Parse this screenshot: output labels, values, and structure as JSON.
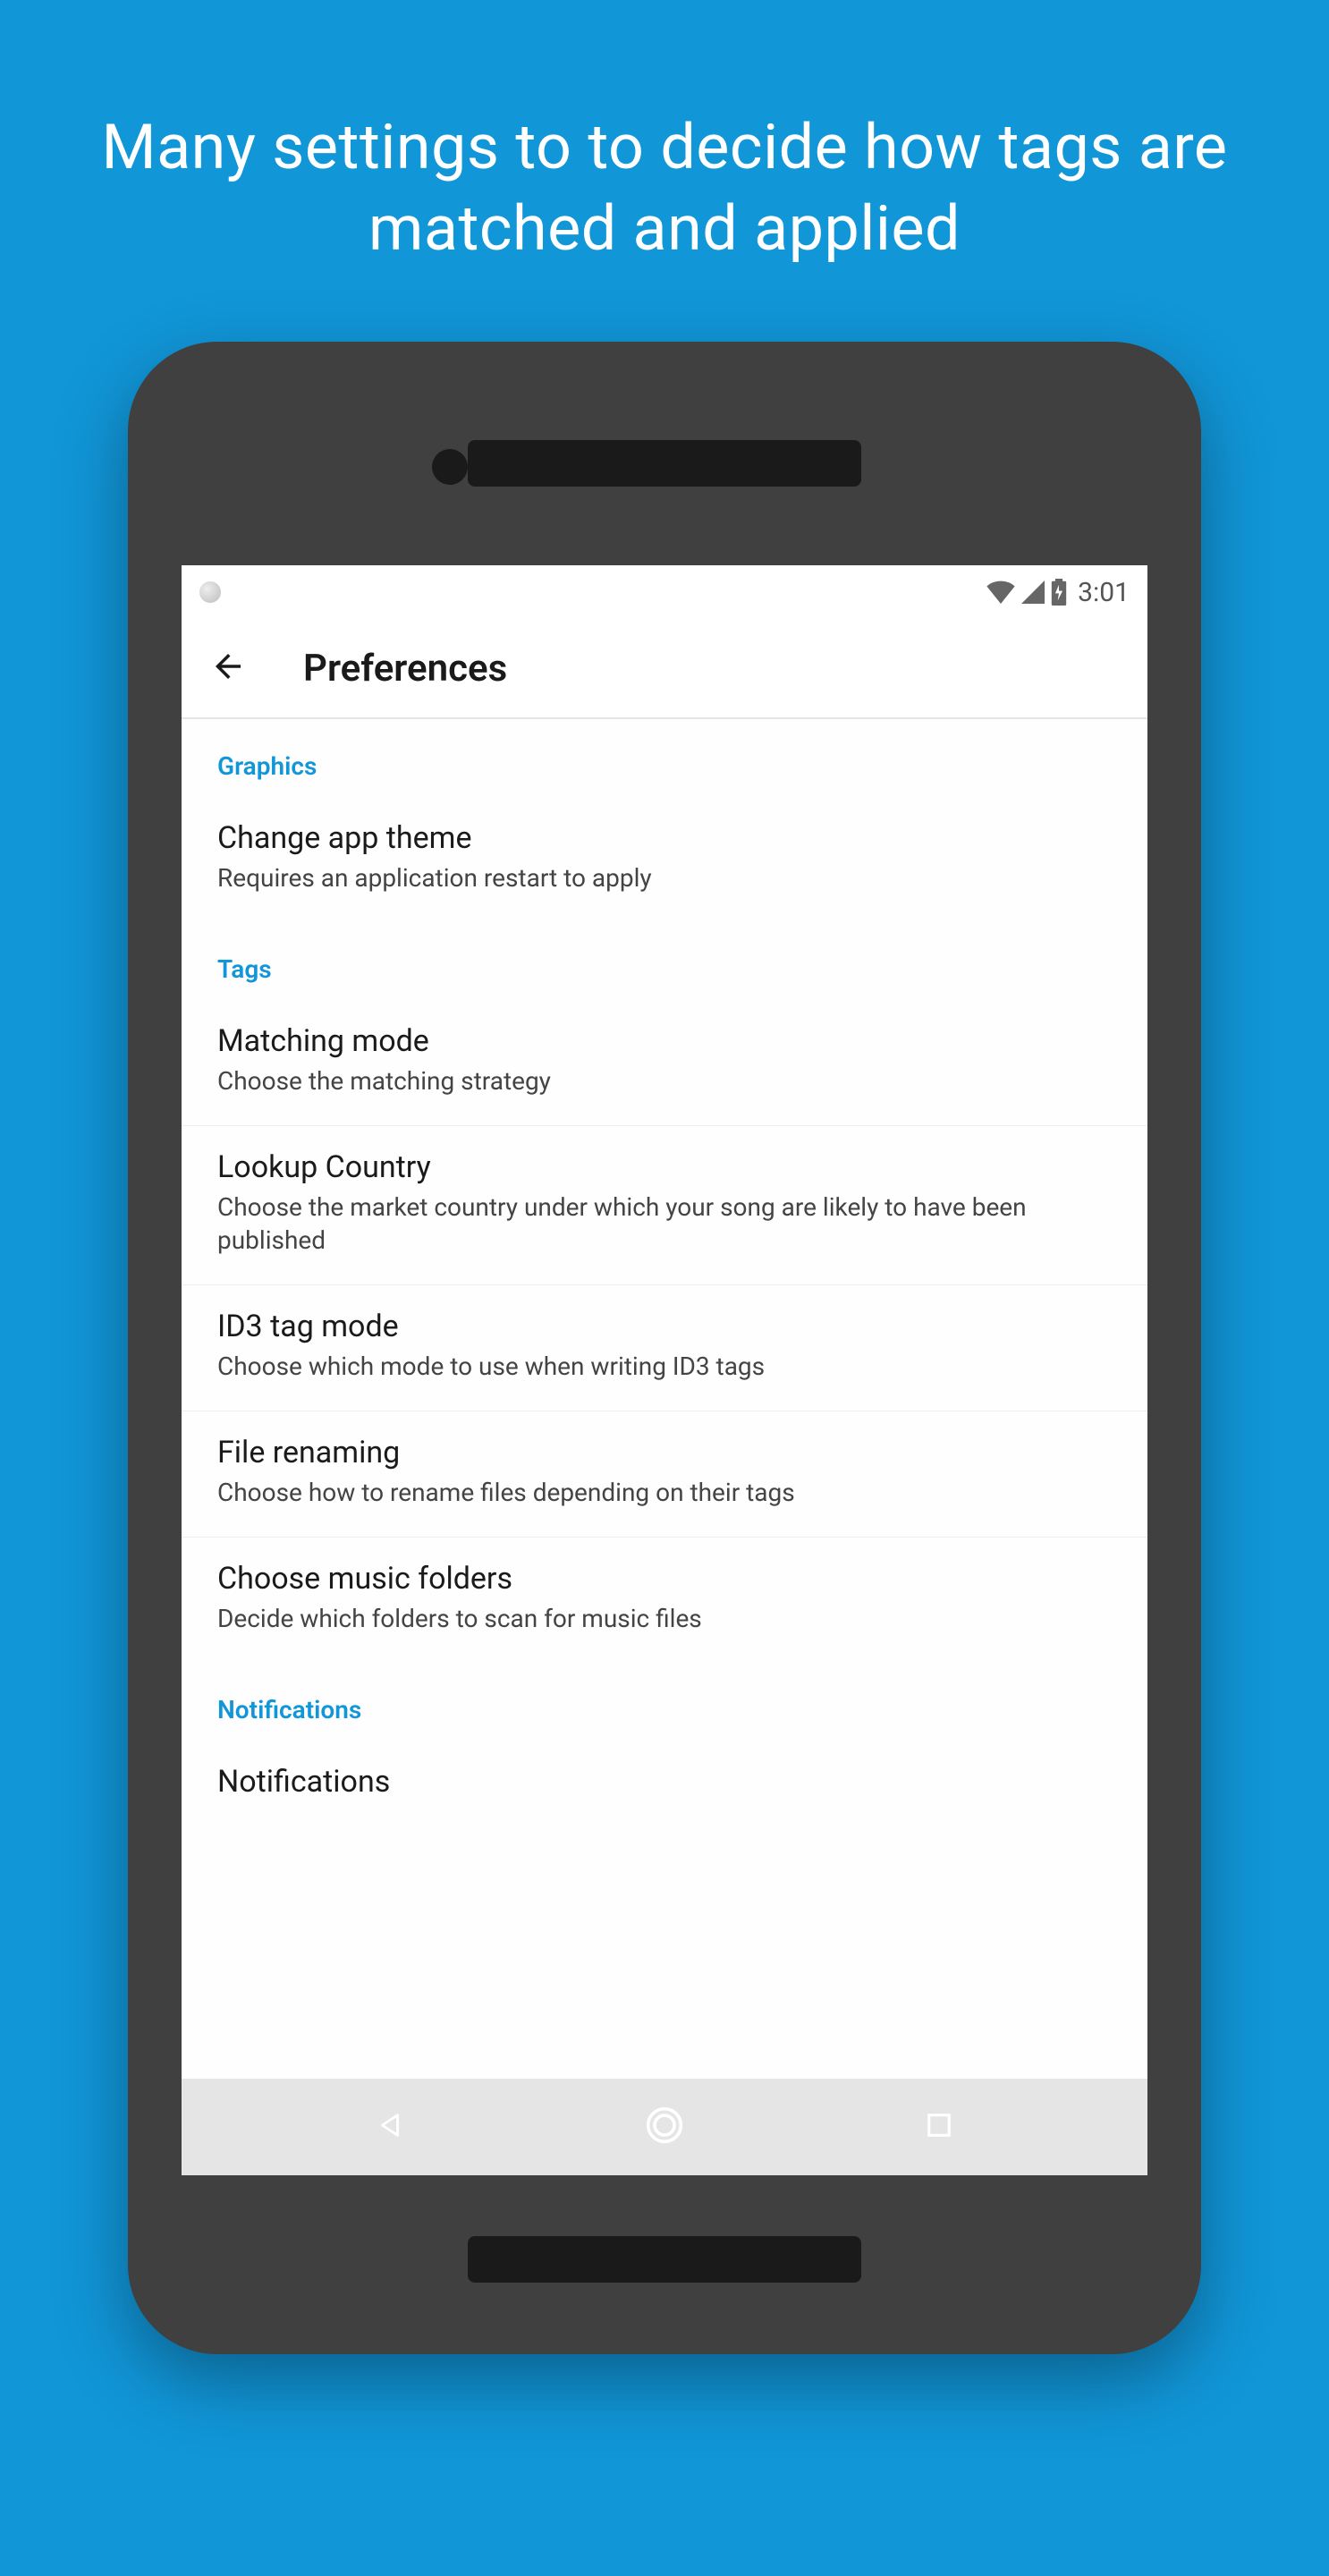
{
  "promo": {
    "headline": "Many settings to to decide how tags are matched and applied"
  },
  "statusbar": {
    "time": "3:01",
    "icons": {
      "wifi": "wifi-icon",
      "cell": "cell-signal-icon",
      "battery": "battery-charging-icon"
    }
  },
  "appbar": {
    "title": "Preferences",
    "back_icon": "arrow-back-icon"
  },
  "sections": [
    {
      "header": "Graphics",
      "items": [
        {
          "title": "Change app theme",
          "subtitle": "Requires an application restart to apply",
          "bordered": false
        }
      ]
    },
    {
      "header": "Tags",
      "items": [
        {
          "title": "Matching mode",
          "subtitle": "Choose the matching strategy",
          "bordered": true
        },
        {
          "title": "Lookup Country",
          "subtitle": "Choose the market country under which your song are likely to have been published",
          "bordered": true
        },
        {
          "title": "ID3 tag mode",
          "subtitle": "Choose which mode to use when writing ID3 tags",
          "bordered": true
        },
        {
          "title": "File renaming",
          "subtitle": "Choose how to rename files depending on their tags",
          "bordered": true
        },
        {
          "title": "Choose music folders",
          "subtitle": "Decide which folders to scan for music files",
          "bordered": false
        }
      ]
    },
    {
      "header": "Notifications",
      "items": [
        {
          "title": "Notifications",
          "subtitle": "",
          "bordered": false
        }
      ]
    }
  ],
  "navbar": {
    "back": "nav-back-icon",
    "home": "nav-home-icon",
    "recent": "nav-recent-icon"
  }
}
